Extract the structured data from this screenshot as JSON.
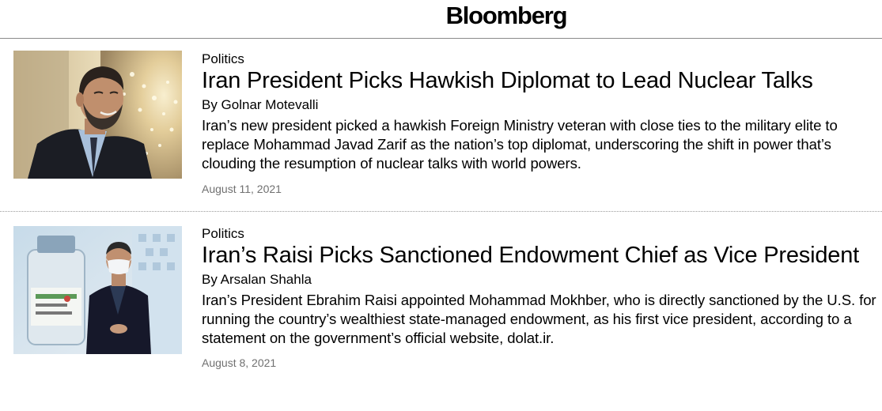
{
  "header": {
    "logo": "Bloomberg"
  },
  "stories": [
    {
      "category": "Politics",
      "headline": "Iran President Picks Hawkish Diplomat to Lead Nuclear Talks",
      "byline": "By Golnar Motevalli",
      "summary": "Iran’s new president picked a hawkish Foreign Ministry veteran with close ties to the military elite to replace Mohammad Javad Zarif as the nation’s top diplomat, underscoring the shift in power that’s clouding the resumption of nuclear talks with world powers.",
      "date": "August 11, 2021"
    },
    {
      "category": "Politics",
      "headline": "Iran’s Raisi Picks Sanctioned Endowment Chief as Vice President",
      "byline": "By Arsalan Shahla",
      "summary": "Iran’s President Ebrahim Raisi appointed Mohammad Mokhber, who is directly sanctioned by the U.S. for running the country’s wealthiest state-managed endowment, as his first vice president, according to a statement on the government’s official website, dolat.ir.",
      "date": "August 8, 2021"
    }
  ]
}
